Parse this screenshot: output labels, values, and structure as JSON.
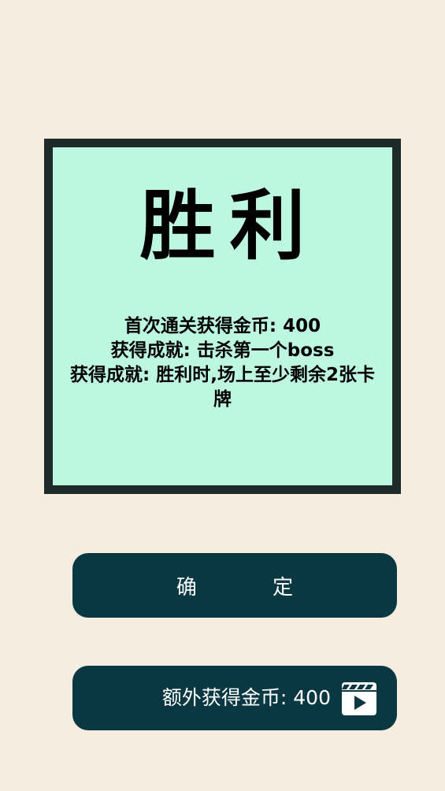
{
  "result": {
    "title": "胜利",
    "rewards": [
      "首次通关获得金币: 400",
      "获得成就: 击杀第一个boss",
      "获得成就: 胜利时,场上至少剩余2张卡牌"
    ]
  },
  "buttons": {
    "confirm_label": "确 定",
    "extra_coins_label": "额外获得金币: 400",
    "extra_coins_icon": "video-play-icon"
  },
  "colors": {
    "background": "#f5eee0",
    "panel_bg": "#bdf7e1",
    "panel_border": "#1d2a28",
    "button_bg": "#093843",
    "button_text": "#ffffff"
  }
}
